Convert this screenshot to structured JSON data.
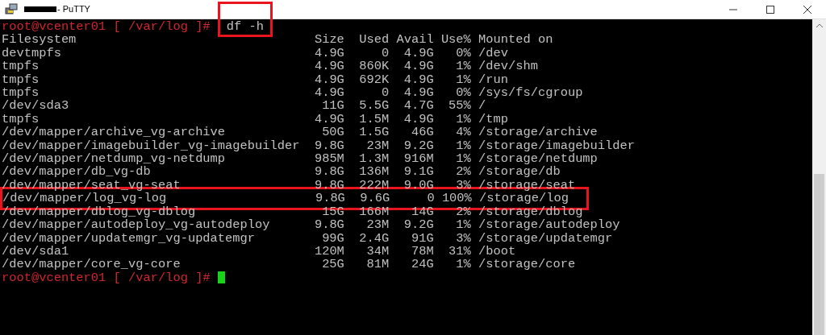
{
  "window": {
    "title": "- PuTTY"
  },
  "terminal": {
    "command_line": {
      "prompt": "root@vcenter01 [ /var/log ]#",
      "command": "df -h",
      "highlighted": true
    },
    "header": [
      "Filesystem",
      "Size",
      "Used",
      "Avail",
      "Use%",
      "Mounted on"
    ],
    "rows": [
      {
        "filesystem": "devtmpfs",
        "size": "4.9G",
        "used": "0",
        "avail": "4.9G",
        "use": "0%",
        "mounted": "/dev",
        "highlighted": false
      },
      {
        "filesystem": "tmpfs",
        "size": "4.9G",
        "used": "860K",
        "avail": "4.9G",
        "use": "1%",
        "mounted": "/dev/shm",
        "highlighted": false
      },
      {
        "filesystem": "tmpfs",
        "size": "4.9G",
        "used": "692K",
        "avail": "4.9G",
        "use": "1%",
        "mounted": "/run",
        "highlighted": false
      },
      {
        "filesystem": "tmpfs",
        "size": "4.9G",
        "used": "0",
        "avail": "4.9G",
        "use": "0%",
        "mounted": "/sys/fs/cgroup",
        "highlighted": false
      },
      {
        "filesystem": "/dev/sda3",
        "size": "11G",
        "used": "5.5G",
        "avail": "4.7G",
        "use": "55%",
        "mounted": "/",
        "highlighted": false
      },
      {
        "filesystem": "tmpfs",
        "size": "4.9G",
        "used": "1.5M",
        "avail": "4.9G",
        "use": "1%",
        "mounted": "/tmp",
        "highlighted": false
      },
      {
        "filesystem": "/dev/mapper/archive_vg-archive",
        "size": "50G",
        "used": "1.5G",
        "avail": "46G",
        "use": "4%",
        "mounted": "/storage/archive",
        "highlighted": false
      },
      {
        "filesystem": "/dev/mapper/imagebuilder_vg-imagebuilder",
        "size": "9.8G",
        "used": "23M",
        "avail": "9.2G",
        "use": "1%",
        "mounted": "/storage/imagebuilder",
        "highlighted": false
      },
      {
        "filesystem": "/dev/mapper/netdump_vg-netdump",
        "size": "985M",
        "used": "1.3M",
        "avail": "916M",
        "use": "1%",
        "mounted": "/storage/netdump",
        "highlighted": false
      },
      {
        "filesystem": "/dev/mapper/db_vg-db",
        "size": "9.8G",
        "used": "136M",
        "avail": "9.1G",
        "use": "2%",
        "mounted": "/storage/db",
        "highlighted": false
      },
      {
        "filesystem": "/dev/mapper/seat_vg-seat",
        "size": "9.8G",
        "used": "222M",
        "avail": "9.0G",
        "use": "3%",
        "mounted": "/storage/seat",
        "highlighted": false
      },
      {
        "filesystem": "/dev/mapper/log_vg-log",
        "size": "9.8G",
        "used": "9.6G",
        "avail": "0",
        "use": "100%",
        "mounted": "/storage/log",
        "highlighted": true
      },
      {
        "filesystem": "/dev/mapper/dblog_vg-dblog",
        "size": "15G",
        "used": "166M",
        "avail": "14G",
        "use": "2%",
        "mounted": "/storage/dblog",
        "highlighted": false
      },
      {
        "filesystem": "/dev/mapper/autodeploy_vg-autodeploy",
        "size": "9.8G",
        "used": "23M",
        "avail": "9.2G",
        "use": "1%",
        "mounted": "/storage/autodeploy",
        "highlighted": false
      },
      {
        "filesystem": "/dev/mapper/updatemgr_vg-updatemgr",
        "size": "99G",
        "used": "2.4G",
        "avail": "91G",
        "use": "3%",
        "mounted": "/storage/updatemgr",
        "highlighted": false
      },
      {
        "filesystem": "/dev/sda1",
        "size": "120M",
        "used": "34M",
        "avail": "78M",
        "use": "31%",
        "mounted": "/boot",
        "highlighted": false
      },
      {
        "filesystem": "/dev/mapper/core_vg-core",
        "size": "25G",
        "used": "81M",
        "avail": "24G",
        "use": "1%",
        "mounted": "/storage/core",
        "highlighted": false
      }
    ],
    "final_prompt": "root@vcenter01 [ /var/log ]#"
  }
}
